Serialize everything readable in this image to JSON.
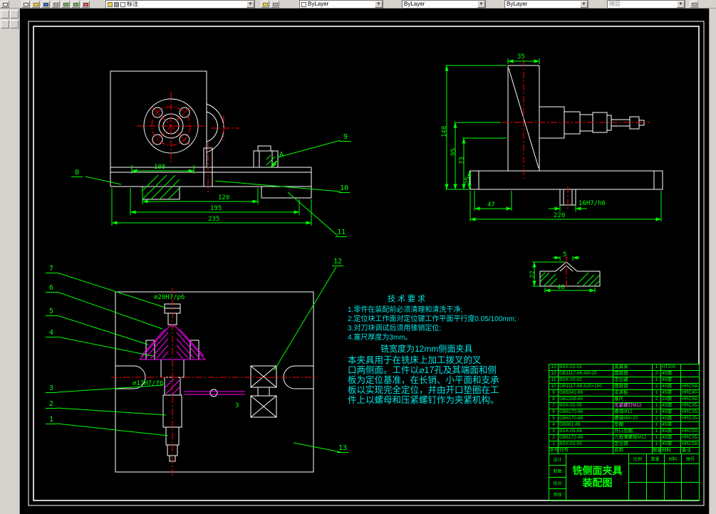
{
  "toolbar": {
    "layer_combo": "标注",
    "color_combo": "ByLayer",
    "linetype_combo": "ByLayer",
    "lineweight_combo": "ByLayer",
    "plotstyle_combo": "随层"
  },
  "drawing": {
    "colors": {
      "geometry": "#ffffff",
      "dimension": "#00ff00",
      "centerline": "#ff0000",
      "auxiliary": "#ff00ff",
      "annotation": "#00e5e5",
      "background": "#000000"
    },
    "front_view": {
      "dim_108": "108",
      "dim_120": "120",
      "dim_195": "195",
      "dim_235": "235",
      "section_label": "A"
    },
    "side_view": {
      "dim_35": "35",
      "dim_148": "148",
      "dim_95": "95",
      "dim_73": "73",
      "dim_25": "25",
      "dim_47": "47",
      "dim_220": "220",
      "fit_16": "16H7/h6"
    },
    "plan_view": {
      "fit_20": "⌀20H7/p6",
      "fit_17": "⌀17H7/f6",
      "dim_3": "3"
    },
    "detail_view": {
      "dim_22": "22",
      "dim_40": "40",
      "dim_5": "5"
    },
    "balloons": [
      "1",
      "2",
      "3",
      "4",
      "5",
      "6",
      "7",
      "8",
      "9",
      "10",
      "11",
      "12",
      "13"
    ],
    "tech_requirements": {
      "title": "技术要求",
      "items": [
        "1.零件在装配前必须清理和清洗干净;",
        "2.定位块工作面对定位键工作平面平行度0.05/100mm;",
        "3.对刀块调试后须用锥销定位;",
        "4.塞尺厚度为3mm。"
      ]
    },
    "description": {
      "title": "铣宽度为12mm侧面夹具",
      "lines": [
        "本夹具用于在铣床上加工拨叉的叉",
        "口两侧面。工件以⌀17孔及其端面和侧",
        "板为定位基准，在长销、小平面和支承",
        "板以实现完全定位，并由开口垫圈在工",
        "件上以螺母和压紧螺钉作为夹紧机构。"
      ]
    }
  },
  "bom": {
    "headers": [
      "序号",
      "代号",
      "名称",
      "数量",
      "材料",
      "备注"
    ],
    "rows": [
      {
        "seq": "13",
        "code": "BSX-02-01",
        "name": "夹具体",
        "qty": "1",
        "material": "HT200",
        "note": ""
      },
      {
        "seq": "12",
        "code": "GB1117-86 A8×20",
        "name": "圆锥销",
        "qty": "2",
        "material": "45钢",
        "note": ""
      },
      {
        "seq": "11",
        "code": "BSX-02-02",
        "name": "定位键",
        "qty": "1",
        "material": "45钢",
        "note": ""
      },
      {
        "seq": "10",
        "code": "GB1117-86 A20×100",
        "name": "圆锥销",
        "qty": "2",
        "material": "45钢",
        "note": "HRC58-64"
      },
      {
        "seq": "9",
        "code": "GB6341-86",
        "name": "支承板",
        "qty": "1",
        "material": "45钢",
        "note": "HRC40-45"
      },
      {
        "seq": "8",
        "code": "GB2208-80",
        "name": "塞尺",
        "qty": "2",
        "material": "20钢",
        "note": "HRC58-64"
      },
      {
        "seq": "7",
        "code": "BSX-02-05",
        "name": "压紧螺钉M12",
        "qty": "1",
        "material": "45钢",
        "note": "HRC35-40",
        "name_color": "#ff82ff"
      },
      {
        "seq": "6",
        "code": "GB6170-86",
        "name": "螺母M12",
        "qty": "1",
        "material": "45钢",
        "note": "HRC35-40"
      },
      {
        "seq": "5",
        "code": "GB6170-86",
        "name": "螺母M8×20",
        "qty": "2",
        "material": "45钢",
        "note": "HRC35-40"
      },
      {
        "seq": "4",
        "code": "GB861-88",
        "name": "垫圈",
        "qty": "1",
        "material": "45钢",
        "note": ""
      },
      {
        "seq": "3",
        "code": "BSX-05-04",
        "name": "开口垫圈",
        "qty": "1",
        "material": "45钢",
        "note": "HRC50-55"
      },
      {
        "seq": "2",
        "code": "GB6172-86",
        "name": "六角薄螺母M12",
        "qty": "1",
        "material": "45钢",
        "note": "HRC35-40"
      },
      {
        "seq": "1",
        "code": "BSX-02-03",
        "name": "定位销",
        "qty": "1",
        "material": "45钢",
        "note": "HRC58-64"
      }
    ]
  },
  "title_block": {
    "name_lines": [
      "铣侧面夹具",
      "装配图"
    ],
    "left_labels": [
      "设计",
      "制图",
      "校对",
      "审核"
    ],
    "field_labels": [
      "比例",
      "数量",
      "材料",
      "图号"
    ]
  }
}
